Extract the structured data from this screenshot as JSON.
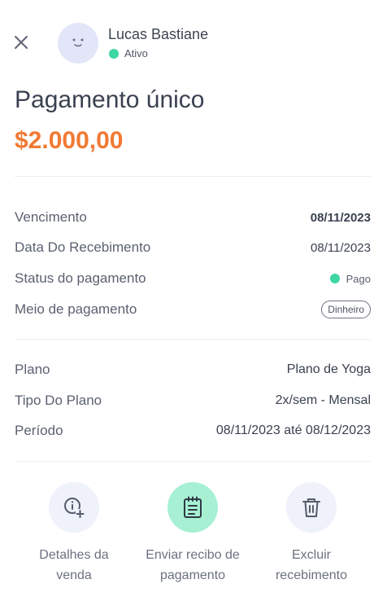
{
  "header": {
    "user_name": "Lucas Bastiane",
    "status": "Ativo"
  },
  "title": "Pagamento único",
  "amount": "$2.000,00",
  "payment_details": {
    "rows": [
      {
        "label": "Vencimento",
        "value": "08/11/2023"
      },
      {
        "label": "Data Do Recebimento",
        "value": "08/11/2023"
      },
      {
        "label": "Status do pagamento",
        "value": "Pago"
      },
      {
        "label": "Meio de pagamento",
        "value": "Dinheiro"
      }
    ]
  },
  "plan_details": {
    "rows": [
      {
        "label": "Plano",
        "value": "Plano de Yoga"
      },
      {
        "label": "Tipo Do Plano",
        "value": "2x/sem - Mensal"
      },
      {
        "label": "Período",
        "value": "08/11/2023 até 08/12/2023"
      }
    ]
  },
  "actions": {
    "sale_details": {
      "line1": "Detalhes da",
      "line2": "venda",
      "icon": "info-plus-icon"
    },
    "send_receipt": {
      "line1": "Enviar recibo de",
      "line2": "pagamento",
      "icon": "receipt-icon"
    },
    "delete": {
      "line1": "Excluir",
      "line2": "recebimento",
      "icon": "trash-icon"
    }
  },
  "colors": {
    "accent_orange": "#f07a33",
    "status_green": "#3ed6a2",
    "avatar_bg": "#e3e6f8",
    "action_bg": "#eff1fb",
    "action_highlight": "#a7f0d3"
  }
}
